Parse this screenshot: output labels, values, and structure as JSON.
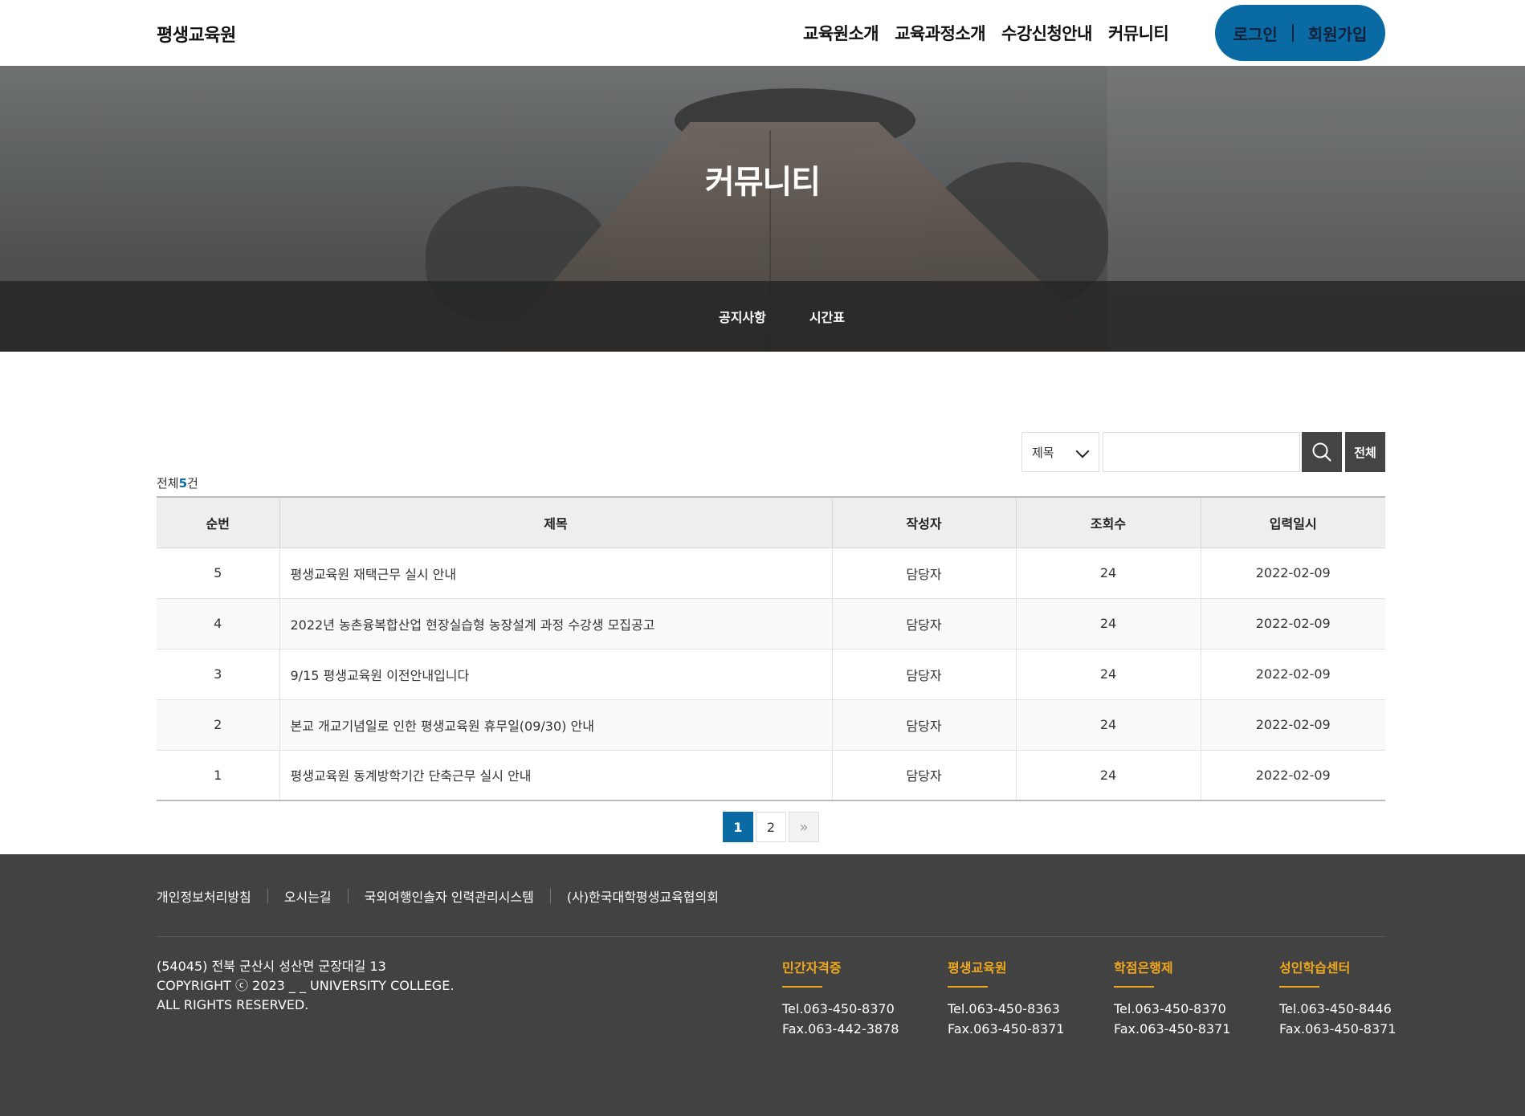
{
  "header": {
    "logo": "평생교육원",
    "nav": [
      "교육원소개",
      "교육과정소개",
      "수강신청안내",
      "커뮤니티"
    ],
    "login": "로그인",
    "join": "회원가입",
    "accent_color": "#0a6ba4"
  },
  "hero": {
    "title": "커뮤니티",
    "subnav": [
      "공지사항",
      "시간표"
    ]
  },
  "search": {
    "field_selected": "제목",
    "input_value": "",
    "all_label": "전체",
    "search_icon": "search-icon"
  },
  "count": {
    "prefix": "전체",
    "total": "5",
    "suffix": "건"
  },
  "table": {
    "headers": [
      "순번",
      "제목",
      "작성자",
      "조회수",
      "입력일시"
    ],
    "rows": [
      {
        "no": "5",
        "title": "평생교육원 재택근무 실시 안내",
        "author": "담당자",
        "views": "24",
        "date": "2022-02-09"
      },
      {
        "no": "4",
        "title": "2022년 농촌융복합산업 현장실습형 농장설계 과정 수강생 모집공고",
        "author": "담당자",
        "views": "24",
        "date": "2022-02-09"
      },
      {
        "no": "3",
        "title": "9/15 평생교육원 이전안내입니다",
        "author": "담당자",
        "views": "24",
        "date": "2022-02-09"
      },
      {
        "no": "2",
        "title": "본교 개교기념일로 인한 평생교육원 휴무일(09/30) 안내",
        "author": "담당자",
        "views": "24",
        "date": "2022-02-09"
      },
      {
        "no": "1",
        "title": "평생교육원 동계방학기간 단축근무 실시 안내",
        "author": "담당자",
        "views": "24",
        "date": "2022-02-09"
      }
    ]
  },
  "pagination": {
    "pages": [
      "1",
      "2"
    ],
    "current": "1",
    "next": "»"
  },
  "footer": {
    "links": [
      "개인정보처리방침",
      "오시는길",
      "국외여행인솔자 인력관리시스템",
      "(사)한국대학평생교육협의회"
    ],
    "address": "(54045) 전북 군산시 성산면 군장대길 13",
    "copyright": "COPYRIGHT ⓒ 2023 _ _ UNIVERSITY COLLEGE.",
    "rights": "ALL RIGHTS RESERVED.",
    "contacts": [
      {
        "name": "민간자격증",
        "tel": "Tel.063-450-8370",
        "fax": "Fax.063-442-3878"
      },
      {
        "name": "평생교육원",
        "tel": "Tel.063-450-8363",
        "fax": "Fax.063-450-8371"
      },
      {
        "name": "학점은행제",
        "tel": "Tel.063-450-8370",
        "fax": "Fax.063-450-8371"
      },
      {
        "name": "성인학습센터",
        "tel": "Tel.063-450-8446",
        "fax": "Fax.063-450-8371"
      }
    ],
    "highlight_color": "#f0a81c"
  }
}
